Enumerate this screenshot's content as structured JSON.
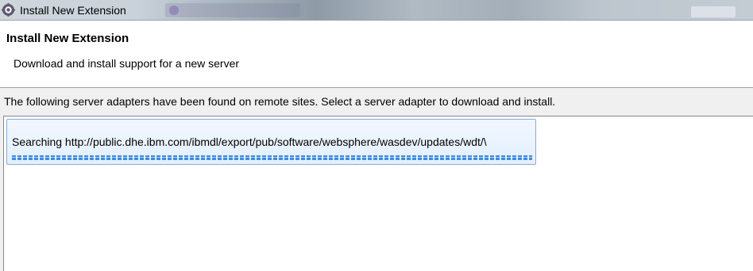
{
  "window": {
    "title": "Install New Extension",
    "icon": "eclipse-gear-icon"
  },
  "header": {
    "title": "Install New Extension",
    "description": "Download and install support for a new server"
  },
  "main": {
    "instruction": "The following server adapters have been found on remote sites. Select a server adapter to download and install.",
    "search_status": "Searching http://public.dhe.ibm.com/ibmdl/export/pub/software/websphere/wasdev/updates/wdt/\\",
    "progress_state": "indeterminate"
  },
  "colors": {
    "progress": "#3b8de6",
    "selection_border": "#84acdd",
    "selection_fill": "#e8f1fd"
  }
}
